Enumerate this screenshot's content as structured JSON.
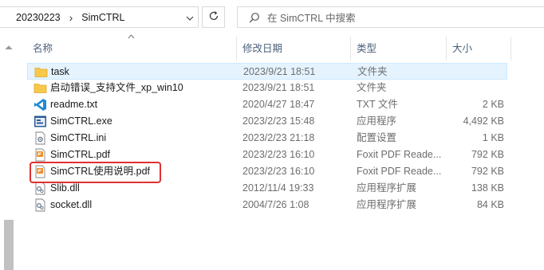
{
  "address": {
    "breadcrumbs": [
      "20230223",
      "SimCTRL"
    ],
    "separator": "›"
  },
  "search": {
    "placeholder": "在 SimCTRL 中搜索"
  },
  "columns": {
    "name": "名称",
    "date": "修改日期",
    "type": "类型",
    "size": "大小"
  },
  "files": [
    {
      "name": "task",
      "date": "2023/9/21 18:51",
      "type": "文件夹",
      "size": "",
      "icon": "folder-icon",
      "selected": true
    },
    {
      "name": "启动错误_支持文件_xp_win10",
      "date": "2023/9/21 18:51",
      "type": "文件夹",
      "size": "",
      "icon": "folder-icon",
      "selected": false
    },
    {
      "name": "readme.txt",
      "date": "2020/4/27 18:47",
      "type": "TXT 文件",
      "size": "2 KB",
      "icon": "vscode-text-file-icon",
      "selected": false
    },
    {
      "name": "SimCTRL.exe",
      "date": "2023/2/23 15:48",
      "type": "应用程序",
      "size": "4,492 KB",
      "icon": "exe-icon",
      "selected": false
    },
    {
      "name": "SimCTRL.ini",
      "date": "2023/2/23 21:18",
      "type": "配置设置",
      "size": "1 KB",
      "icon": "ini-file-icon",
      "selected": false
    },
    {
      "name": "SimCTRL.pdf",
      "date": "2023/2/23 16:10",
      "type": "Foxit PDF Reade...",
      "size": "792 KB",
      "icon": "foxit-pdf-icon",
      "selected": false
    },
    {
      "name": "SimCTRL使用说明.pdf",
      "date": "2023/2/23 16:10",
      "type": "Foxit PDF Reade...",
      "size": "792 KB",
      "icon": "foxit-pdf-icon",
      "selected": false
    },
    {
      "name": "Slib.dll",
      "date": "2012/11/4 19:33",
      "type": "应用程序扩展",
      "size": "138 KB",
      "icon": "dll-icon",
      "selected": false
    },
    {
      "name": "socket.dll",
      "date": "2004/7/26 1:08",
      "type": "应用程序扩展",
      "size": "84 KB",
      "icon": "dll-icon",
      "selected": false
    }
  ],
  "colors": {
    "selection_bg": "#e5f3ff",
    "selection_border": "#cce8ff",
    "annotation_red": "#e03030",
    "folder": "#f8c84a"
  }
}
